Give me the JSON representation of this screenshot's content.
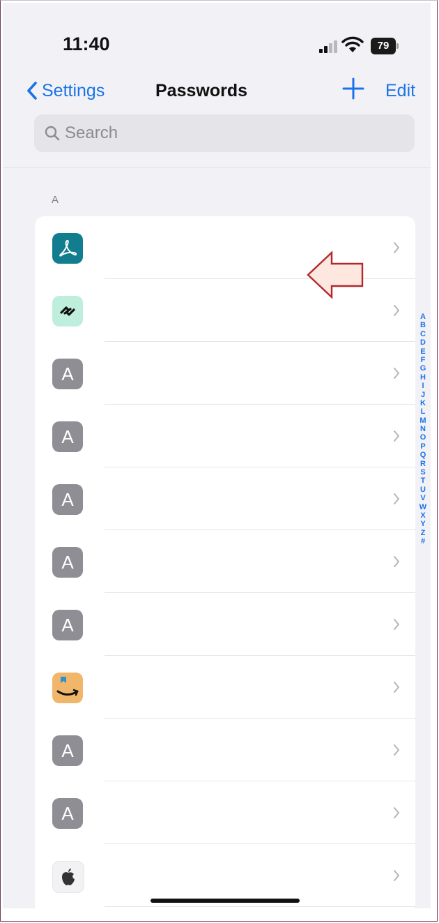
{
  "status_bar": {
    "time": "11:40",
    "battery": "79"
  },
  "nav": {
    "back_label": "Settings",
    "title": "Passwords",
    "edit_label": "Edit"
  },
  "search": {
    "placeholder": "Search"
  },
  "section": {
    "header": "A"
  },
  "rows": [
    {
      "icon": "acrobat-icon",
      "letter": ""
    },
    {
      "icon": "link-icon",
      "letter": ""
    },
    {
      "icon": "generic-letter-icon",
      "letter": "A"
    },
    {
      "icon": "generic-letter-icon",
      "letter": "A"
    },
    {
      "icon": "generic-letter-icon",
      "letter": "A"
    },
    {
      "icon": "generic-letter-icon",
      "letter": "A"
    },
    {
      "icon": "generic-letter-icon",
      "letter": "A"
    },
    {
      "icon": "amazon-icon",
      "letter": ""
    },
    {
      "icon": "generic-letter-icon",
      "letter": "A"
    },
    {
      "icon": "generic-letter-icon",
      "letter": "A"
    },
    {
      "icon": "apple-icon",
      "letter": ""
    }
  ],
  "index_letters": [
    "A",
    "B",
    "C",
    "D",
    "E",
    "F",
    "G",
    "H",
    "I",
    "J",
    "K",
    "L",
    "M",
    "N",
    "O",
    "P",
    "Q",
    "R",
    "S",
    "T",
    "U",
    "V",
    "W",
    "X",
    "Y",
    "Z",
    "#"
  ],
  "colors": {
    "accent": "#1a73e8",
    "generic_icon": "#8e8e94",
    "annotation_arrow": "#b2282f"
  }
}
